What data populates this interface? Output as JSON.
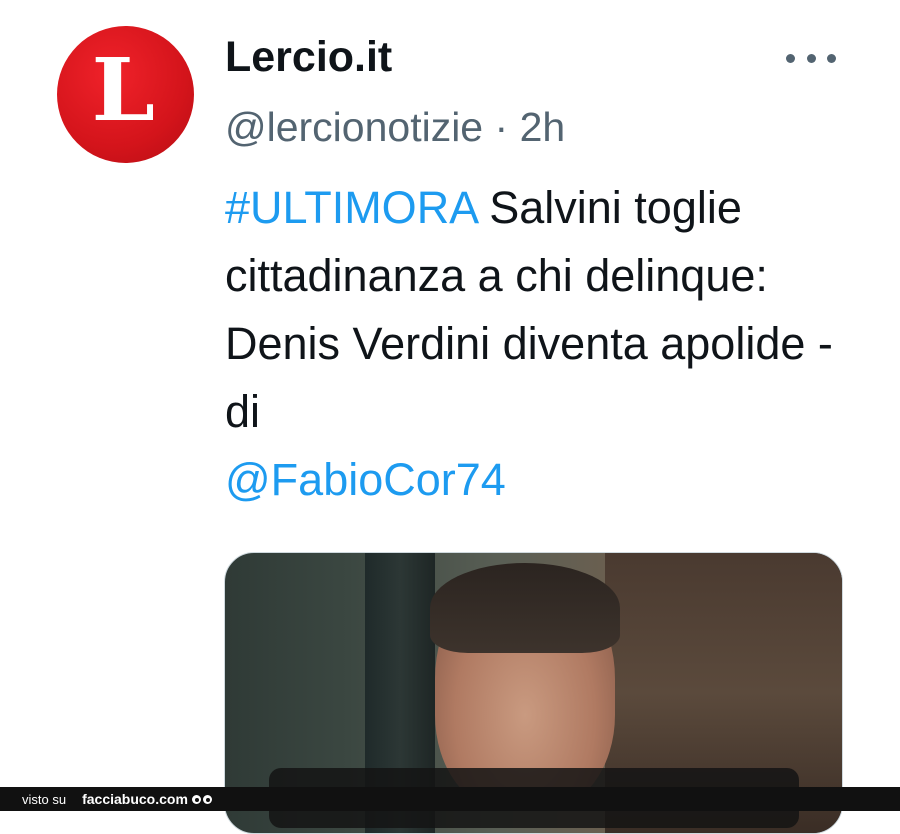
{
  "account": {
    "avatar_letter": "L",
    "name": "Lercio.it",
    "handle": "@lercionotizie",
    "separator": "·",
    "time": "2h"
  },
  "tweet": {
    "hashtag": "#ULTIMORA",
    "text": "Salvini toglie cittadinanza a chi delinque: Denis Verdini diventa apolide - di",
    "mention": "@FabioCor74"
  },
  "icons": {
    "more": "more-horizontal-icon",
    "footer_eyes": "eyes-icon"
  },
  "colors": {
    "link": "#1d9bf0",
    "avatar": "#d4141b",
    "secondary_text": "#536471"
  },
  "footer": {
    "visto": "visto su",
    "site": "facciabuco.com"
  }
}
